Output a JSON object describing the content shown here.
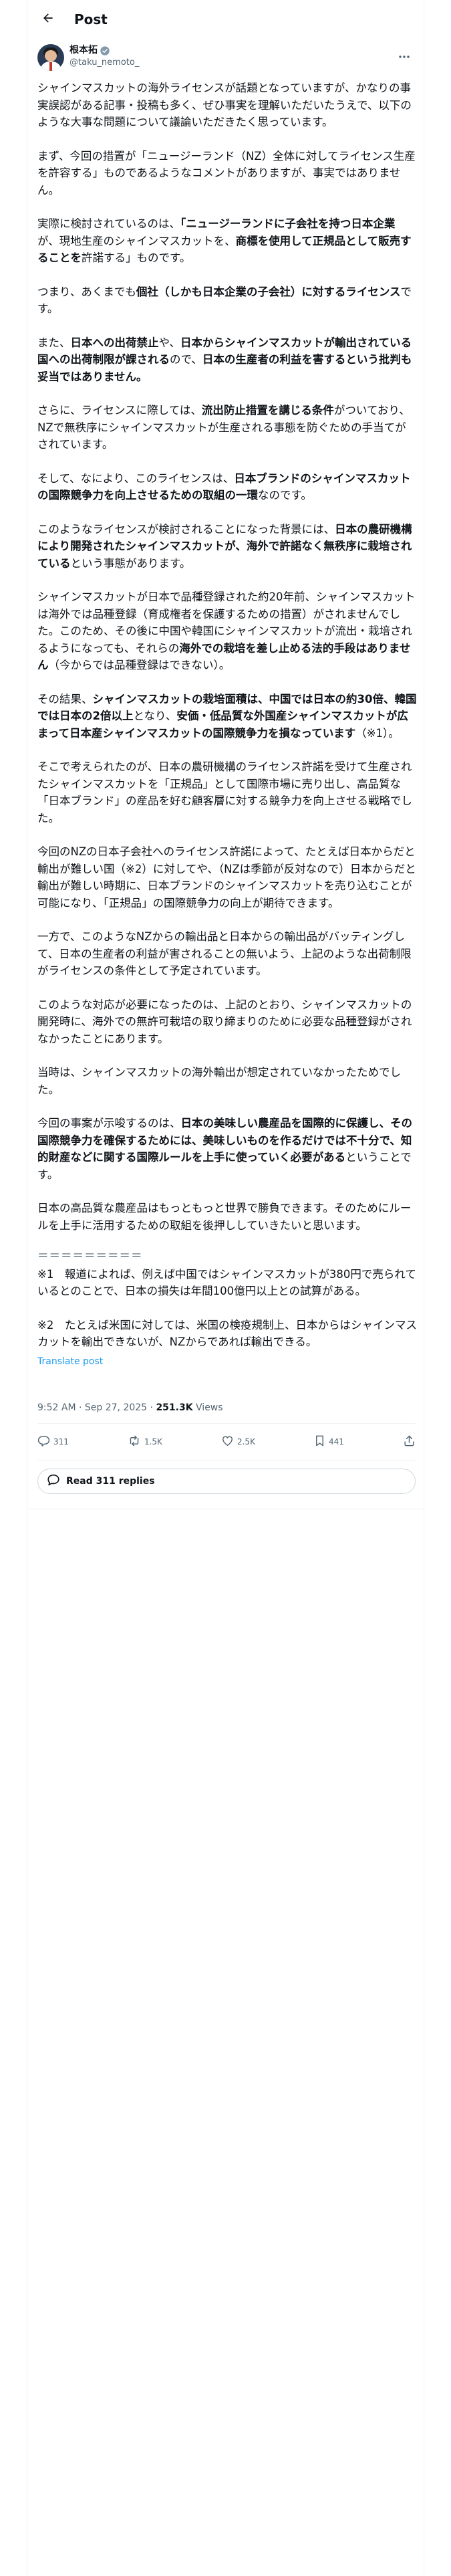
{
  "header": {
    "title": "Post"
  },
  "author": {
    "name": "根本拓",
    "handle": "@taku_nemoto_"
  },
  "post": {
    "p1": "シャインマスカットの海外ライセンスが話題となっていますが、かなりの事実誤認がある記事・投稿も多く、ぜひ事実を理解いただいたうえで、以下のような大事な問題について議論いただきたく思っています。",
    "p2": "まず、今回の措置が「ニュージーランド（NZ）全体に対してライセンス生産を許容する」ものであるようなコメントがありますが、事実ではありません。",
    "p3a": "実際に検討されているのは、",
    "p3b": "「ニュージーランドに子会社を持つ日本企業",
    "p3c": "が、現地生産のシャインマスカットを、",
    "p3d": "商標を使用して正規品として販売することを",
    "p3e": "許諾する」ものです。",
    "p4a": "つまり、あくまでも",
    "p4b": "個社（しかも日本企業の子会社）に対するライセンス",
    "p4c": "です。",
    "p5a": "また、",
    "p5b": "日本への出荷禁止",
    "p5c": "や、",
    "p5d": "日本からシャインマスカットが輸出されている国への出荷制限が課される",
    "p5e": "ので、",
    "p5f": "日本の生産者の利益を害するという批判も妥当ではありません。",
    "p6a": "さらに、ライセンスに際しては、",
    "p6b": "流出防止措置を講じる条件",
    "p6c": "がついており、NZで無秩序にシャインマスカットが生産される事態を防ぐための手当てがされています。",
    "p7a": "そして、なにより、このライセンスは、",
    "p7b": "日本ブランドのシャインマスカットの国際競争力を向上させるための取組の一環",
    "p7c": "なのです。",
    "p8a": "このようなライセンスが検討されることになった背景には、",
    "p8b": "日本の農研機構により開発されたシャインマスカットが、海外で許諾なく無秩序に栽培されている",
    "p8c": "という事態があります。",
    "p9a": "シャインマスカットが日本で品種登録された約20年前、シャインマスカットは海外では品種登録（育成権者を保護するための措置）がされませんでした。このため、その後に中国や韓国にシャインマスカットが流出・栽培されるようになっても、それらの",
    "p9b": "海外での栽培を差し止める法的手段はありません",
    "p9c": "（今からでは品種登録はできない）。",
    "p10a": "その結果、",
    "p10b": "シャインマスカットの栽培面積は、中国では日本の約30倍、韓国では日本の2倍以上",
    "p10c": "となり、",
    "p10d": "安価・低品質な外国産シャインマスカットが広まって日本産シャインマスカットの国際競争力を損なっています",
    "p10e": "（※1）。",
    "p11": "そこで考えられたのが、日本の農研機構のライセンス許諾を受けて生産されたシャインマスカットを「正規品」として国際市場に売り出し、高品質な「日本ブランド」の産品を好む顧客層に対する競争力を向上させる戦略でした。",
    "p12": "今回のNZの日本子会社へのライセンス許諾によって、たとえば日本からだと輸出が難しい国（※2）に対してや、（NZは季節が反対なので）日本からだと輸出が難しい時期に、日本ブランドのシャインマスカットを売り込むことが可能になり、「正規品」の国際競争力の向上が期待できます。",
    "p13": "一方で、このようなNZからの輸出品と日本からの輸出品がバッティングして、日本の生産者の利益が害されることの無いよう、上記のような出荷制限がライセンスの条件として予定されています。",
    "p14": "このような対応が必要になったのは、上記のとおり、シャインマスカットの開発時に、海外での無許可栽培の取り締まりのために必要な品種登録がされなかったことにあります。",
    "p15": "当時は、シャインマスカットの海外輸出が想定されていなかったためでした。",
    "p16a": "今回の事案が示唆するのは、",
    "p16b": "日本の美味しい農産品を国際的に保護し、その国際競争力を確保するためには、美味しいものを作るだけでは不十分で、知的財産などに関する国際ルールを上手に使っていく必要がある",
    "p16c": "ということです。",
    "p17": "日本の高品質な農産品はもっともっと世界で勝負できます。そのためにルールを上手に活用するための取組を後押ししていきたいと思います。",
    "divider": "＝＝＝＝＝＝＝＝＝",
    "note1": "※1　報道によれば、例えば中国ではシャインマスカットが380円で売られているとのことで、日本の損失は年間100億円以上との試算がある。",
    "note2": "※2　たとえば米国に対しては、米国の検疫規制上、日本からはシャインマスカットを輸出できないが、NZからであれば輸出できる。",
    "translate": "Translate post"
  },
  "meta": {
    "time": "9:52 AM · Sep 27, 2025 · ",
    "views_count": "251.3K",
    "views_label": " Views"
  },
  "actions": {
    "replies": "311",
    "reposts": "1.5K",
    "likes": "2.5K",
    "bookmarks": "441"
  },
  "read_replies": "Read 311 replies",
  "colors": {
    "text": "#0f1419",
    "secondary": "#536471",
    "accent": "#1d9bf0",
    "border": "#eff3f4"
  },
  "icons": [
    "back-arrow-icon",
    "verified-badge-icon",
    "more-icon",
    "reply-icon",
    "repost-icon",
    "like-icon",
    "bookmark-icon",
    "share-icon",
    "speech-bubble-icon"
  ]
}
